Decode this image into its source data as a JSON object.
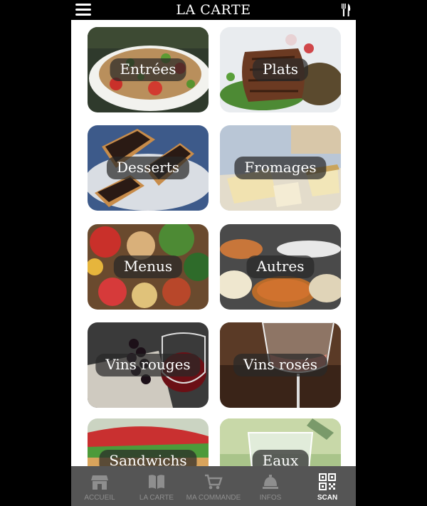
{
  "header": {
    "title": "LA CARTE"
  },
  "categories": [
    {
      "label": "Entrées"
    },
    {
      "label": "Plats"
    },
    {
      "label": "Desserts"
    },
    {
      "label": "Fromages"
    },
    {
      "label": "Menus"
    },
    {
      "label": "Autres"
    },
    {
      "label": "Vins rouges"
    },
    {
      "label": "Vins rosés"
    },
    {
      "label": "Sandwichs"
    },
    {
      "label": "Eaux"
    }
  ],
  "bottom_nav": [
    {
      "label": "ACCUEIL",
      "icon": "store-icon"
    },
    {
      "label": "LA CARTE",
      "icon": "book-icon"
    },
    {
      "label": "MA COMMANDE",
      "icon": "cart-icon"
    },
    {
      "label": "INFOS",
      "icon": "bell-icon"
    },
    {
      "label": "SCAN",
      "icon": "qr-code-icon",
      "active": true
    }
  ],
  "colors": {
    "topbar": "#000000",
    "bottombar": "#555555",
    "nav_inactive": "#8e8e8e",
    "nav_active": "#ffffff"
  }
}
